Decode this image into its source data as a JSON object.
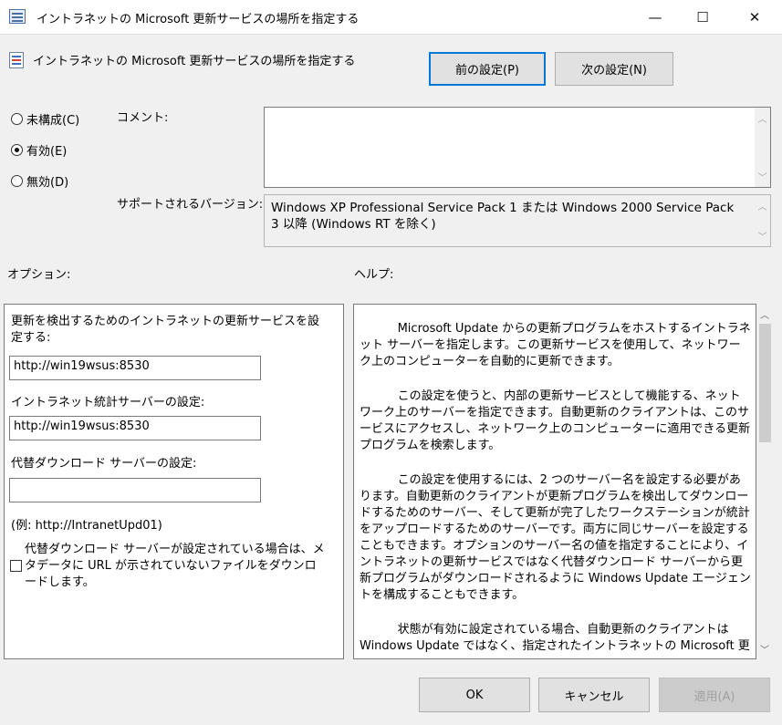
{
  "window": {
    "title": "イントラネットの Microsoft 更新サービスの場所を指定する",
    "minimize": "—",
    "maximize": "☐",
    "close": "✕"
  },
  "header": {
    "policy_title": "イントラネットの Microsoft 更新サービスの場所を指定する",
    "prev_button": "前の設定(P)",
    "next_button": "次の設定(N)"
  },
  "state": {
    "options": [
      {
        "label": "未構成(C)",
        "selected": false
      },
      {
        "label": "有効(E)",
        "selected": true
      },
      {
        "label": "無効(D)",
        "selected": false
      }
    ]
  },
  "comment": {
    "label": "コメント:",
    "value": ""
  },
  "supported": {
    "label": "サポートされるバージョン:",
    "value": "Windows XP Professional Service Pack 1 または Windows 2000 Service Pack 3 以降 (Windows RT を除く)"
  },
  "options_section": {
    "label": "オプション:",
    "update_service_label": "更新を検出するためのイントラネットの更新サービスを設定する:",
    "update_service_value": "http://win19wsus:8530",
    "stats_server_label": "イントラネット統計サーバーの設定:",
    "stats_server_value": "http://win19wsus:8530",
    "alt_download_label": "代替ダウンロード サーバーの設定:",
    "alt_download_value": "",
    "example": "(例: http://IntranetUpd01)",
    "checkbox_label": "代替ダウンロード サーバーが設定されている場合は、メタデータに URL が示されていないファイルをダウンロードします。",
    "checkbox_checked": false
  },
  "help_section": {
    "label": "ヘルプ:",
    "paragraphs": [
      "Microsoft Update からの更新プログラムをホストするイントラネット サーバーを指定します。この更新サービスを使用して、ネットワーク上のコンピューターを自動的に更新できます。",
      "この設定を使うと、内部の更新サービスとして機能する、ネットワーク上のサーバーを指定できます。自動更新のクライアントは、このサービスにアクセスし、ネットワーク上のコンピューターに適用できる更新プログラムを検索します。",
      "この設定を使用するには、2 つのサーバー名を設定する必要があります。自動更新のクライアントが更新プログラムを検出してダウンロードするためのサーバー、そして更新が完了したワークステーションが統計をアップロードするためのサーバーです。両方に同じサーバーを設定することもできます。オプションのサーバー名の値を指定することにより、イントラネットの更新サービスではなく代替ダウンロード サーバーから更新プログラムがダウンロードされるように Windows Update エージェントを構成することもできます。",
      "状態が有効に設定されている場合、自動更新のクライアントは Windows Update ではなく、指定されたイントラネットの Microsoft 更"
    ]
  },
  "footer": {
    "ok": "OK",
    "cancel": "キャンセル",
    "apply": "適用(A)"
  }
}
